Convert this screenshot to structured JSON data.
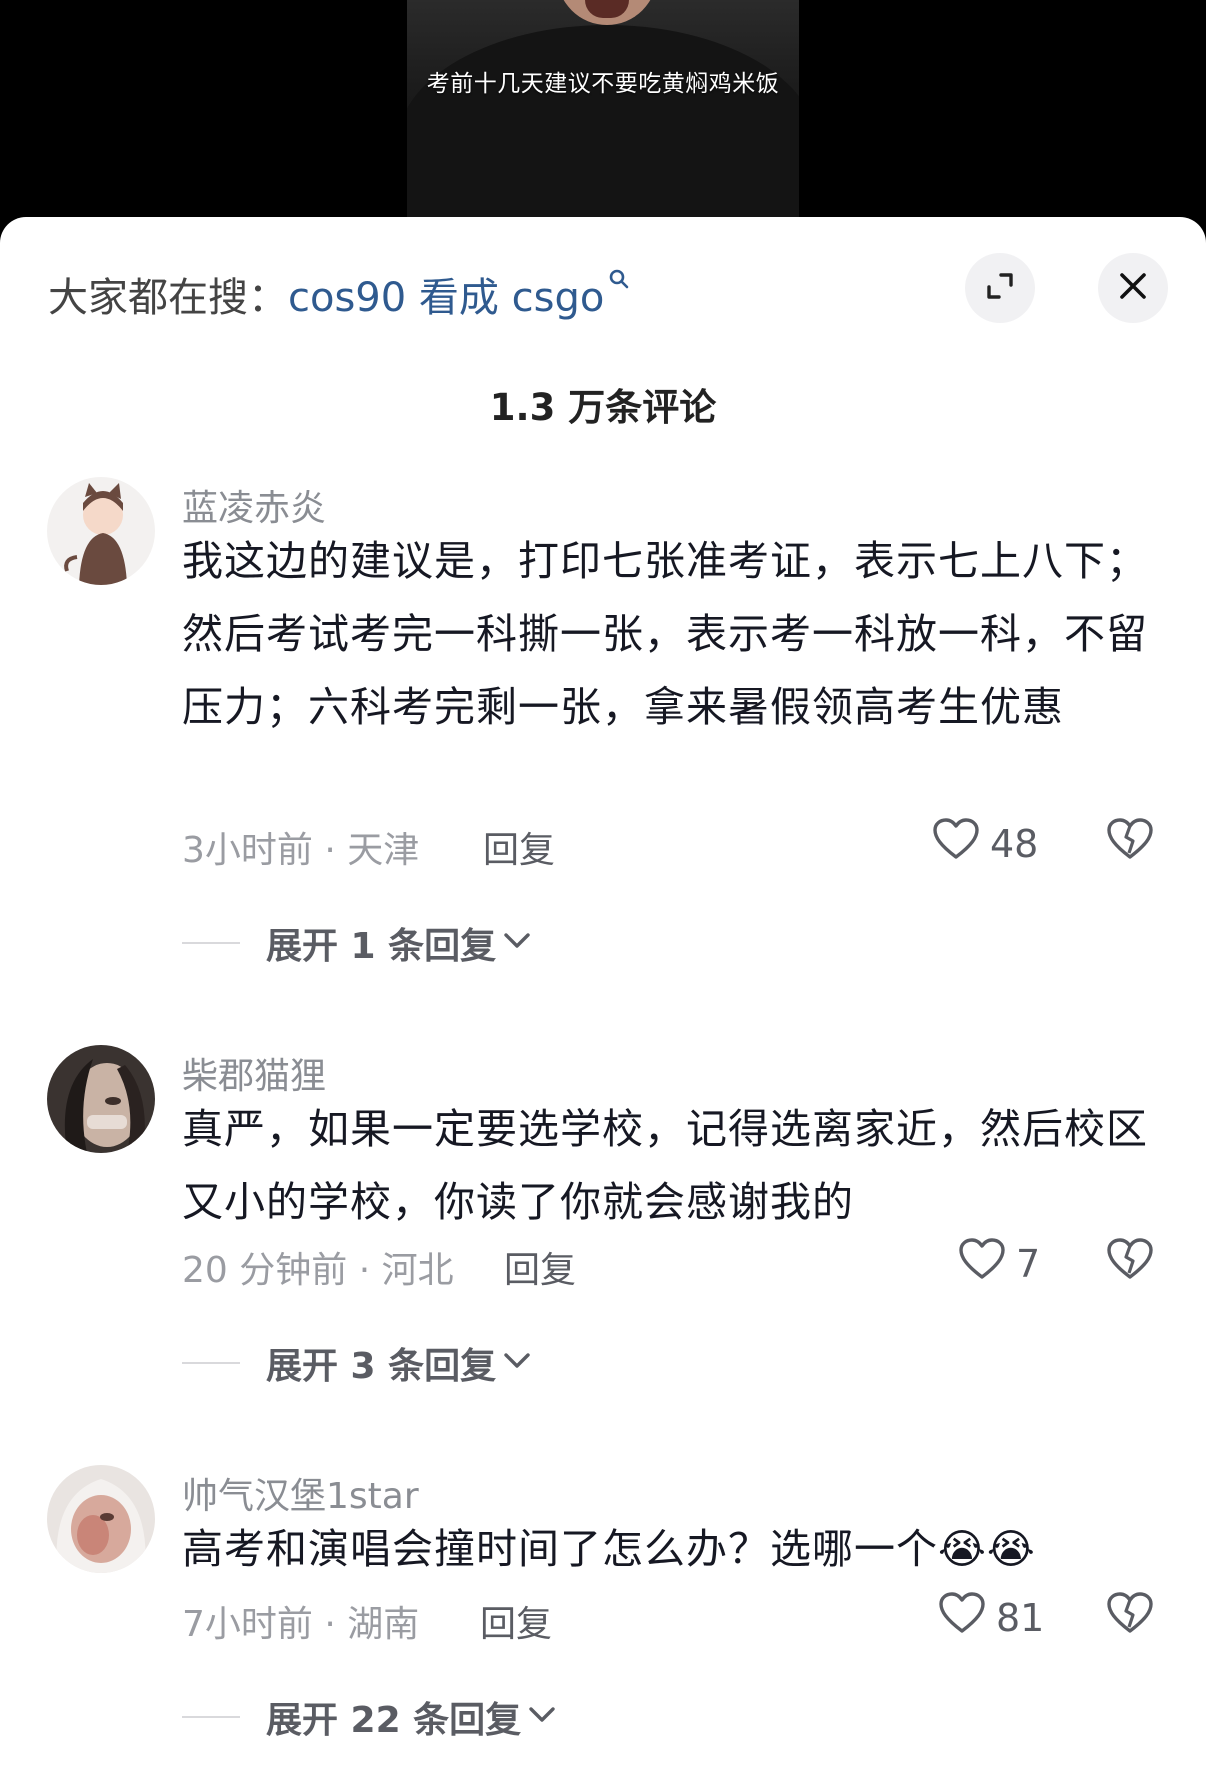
{
  "video": {
    "caption": "考前十几天建议不要吃黄焖鸡米饭"
  },
  "header": {
    "search_prefix": "大家都在搜：",
    "search_term": "cos90 看成 csgo",
    "search_icon": "search-icon",
    "expand_icon": "expand-icon",
    "close_icon": "close-icon"
  },
  "comment_count": "1.3 万条评论",
  "comments": [
    {
      "username": "蓝凌赤炎",
      "content": "我这边的建议是，打印七张准考证，表示七上八下；然后考试考完一科撕一张，表示考一科放一科，不留压力；六科考完剩一张，拿来暑假领高考生优惠",
      "time_location": "3小时前 · 天津",
      "reply_label": "回复",
      "likes": "48",
      "expand_label": "展开 1 条回复"
    },
    {
      "username": "柴郡猫狸",
      "content": "真严，如果一定要选学校，记得选离家近，然后校区又小的学校，你读了你就会感谢我的",
      "time_location": "20 分钟前 · 河北",
      "reply_label": "回复",
      "likes": "7",
      "expand_label": "展开 3 条回复"
    },
    {
      "username": "帅气汉堡1star",
      "content": "高考和演唱会撞时间了怎么办？选哪一个😭😭",
      "time_location": "7小时前 · 湖南",
      "reply_label": "回复",
      "likes": "81",
      "expand_label": "展开 22 条回复"
    }
  ],
  "colors": {
    "accent_link": "#2f5a8f",
    "text_primary": "#161823",
    "text_secondary": "#9a9ca2"
  }
}
